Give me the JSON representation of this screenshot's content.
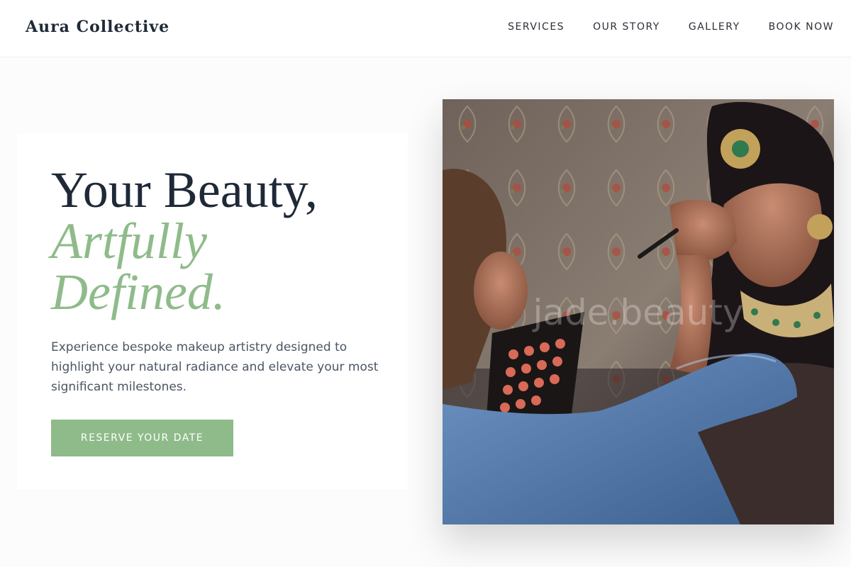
{
  "header": {
    "logo": "Aura Collective",
    "nav": [
      {
        "label": "SERVICES"
      },
      {
        "label": "OUR STORY"
      },
      {
        "label": "GALLERY"
      },
      {
        "label": "BOOK NOW"
      }
    ]
  },
  "hero": {
    "headline_line1": "Your Beauty,",
    "headline_line2": "Artfully",
    "headline_line3": "Defined.",
    "description": "Experience bespoke makeup artistry designed to highlight your natural radiance and elevate your most significant milestones.",
    "cta_label": "RESERVE YOUR DATE",
    "photo_watermark": "jade.beauty"
  },
  "colors": {
    "accent": "#8fbb8a",
    "text_dark": "#1f2937",
    "text_body": "#4b5563",
    "background": "#fcfcfc"
  }
}
